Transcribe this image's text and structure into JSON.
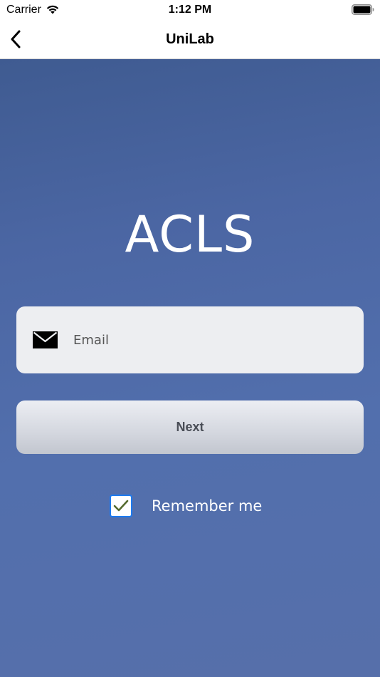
{
  "status_bar": {
    "carrier": "Carrier",
    "time": "1:12 PM"
  },
  "nav": {
    "title": "UniLab",
    "back_icon": "chevron-left-icon"
  },
  "main": {
    "logo_text": "ACLS",
    "email": {
      "placeholder": "Email",
      "value": "",
      "icon": "mail-icon"
    },
    "next_label": "Next",
    "remember": {
      "label": "Remember me",
      "checked": true
    }
  },
  "colors": {
    "background_top": "#3f5b91",
    "background_bottom": "#566faa",
    "field_bg": "#edeef1",
    "checkbox_border": "#1e7bf0",
    "checkmark": "#556b2f"
  }
}
